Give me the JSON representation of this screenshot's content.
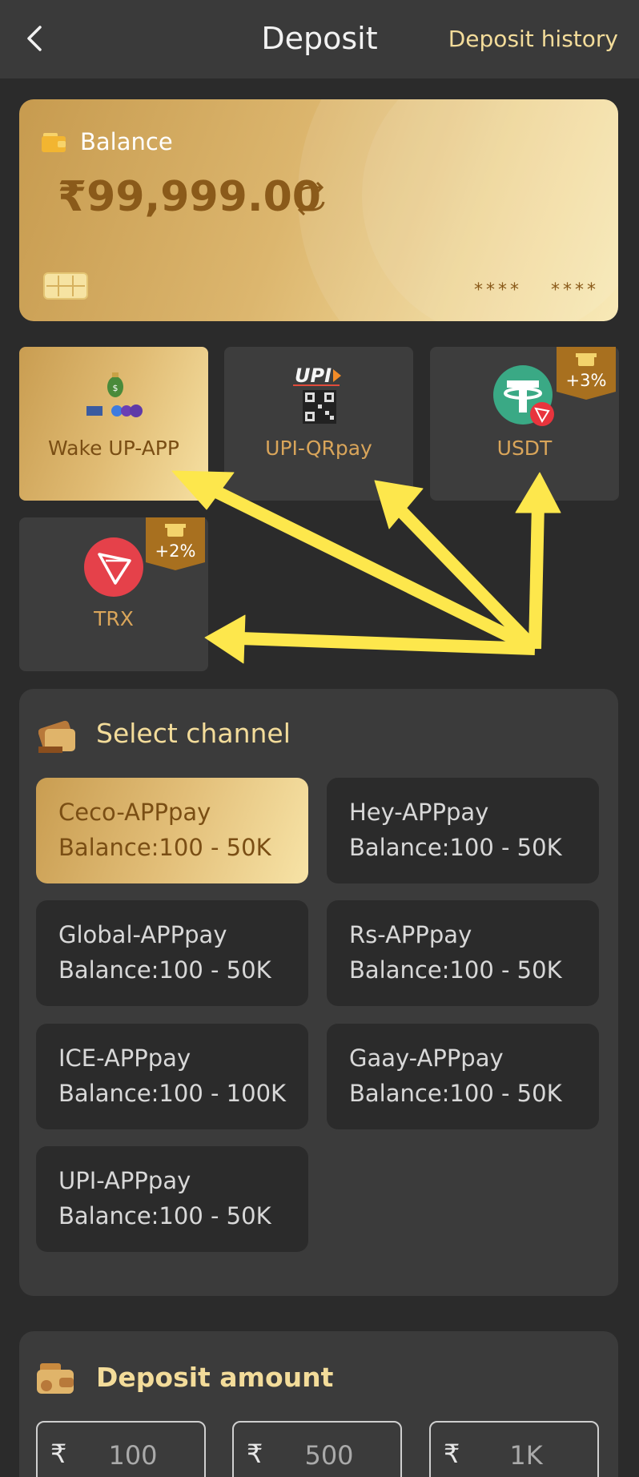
{
  "header": {
    "title": "Deposit",
    "history_link": "Deposit history"
  },
  "balance_card": {
    "label": "Balance",
    "amount": "₹99,999.00",
    "mask1": "****",
    "mask2": "****"
  },
  "payment_methods": [
    {
      "label": "Wake UP-APP",
      "selected": true,
      "bonus": ""
    },
    {
      "label": "UPI-QRpay",
      "selected": false,
      "bonus": ""
    },
    {
      "label": "USDT",
      "selected": false,
      "bonus": "+3%"
    },
    {
      "label": "TRX",
      "selected": false,
      "bonus": "+2%"
    }
  ],
  "channel_section": {
    "title": "Select channel",
    "channels": [
      {
        "name": "Ceco-APPpay",
        "range": "Balance:100 - 50K",
        "selected": true
      },
      {
        "name": "Hey-APPpay",
        "range": "Balance:100 - 50K",
        "selected": false
      },
      {
        "name": "Global-APPpay",
        "range": "Balance:100 - 50K",
        "selected": false
      },
      {
        "name": "Rs-APPpay",
        "range": "Balance:100 - 50K",
        "selected": false
      },
      {
        "name": "ICE-APPpay",
        "range": "Balance:100 - 100K",
        "selected": false
      },
      {
        "name": "Gaay-APPpay",
        "range": "Balance:100 - 50K",
        "selected": false
      },
      {
        "name": "UPI-APPpay",
        "range": "Balance:100 - 50K",
        "selected": false
      }
    ]
  },
  "amount_section": {
    "title": "Deposit amount",
    "currency_symbol": "₹",
    "presets": [
      "100",
      "500",
      "1K"
    ]
  },
  "colors": {
    "accent": "#f3dc9a",
    "gold_dark": "#7a4e14",
    "background": "#2b2b2b",
    "panel": "#3b3b3b",
    "arrow": "#fde74c"
  }
}
